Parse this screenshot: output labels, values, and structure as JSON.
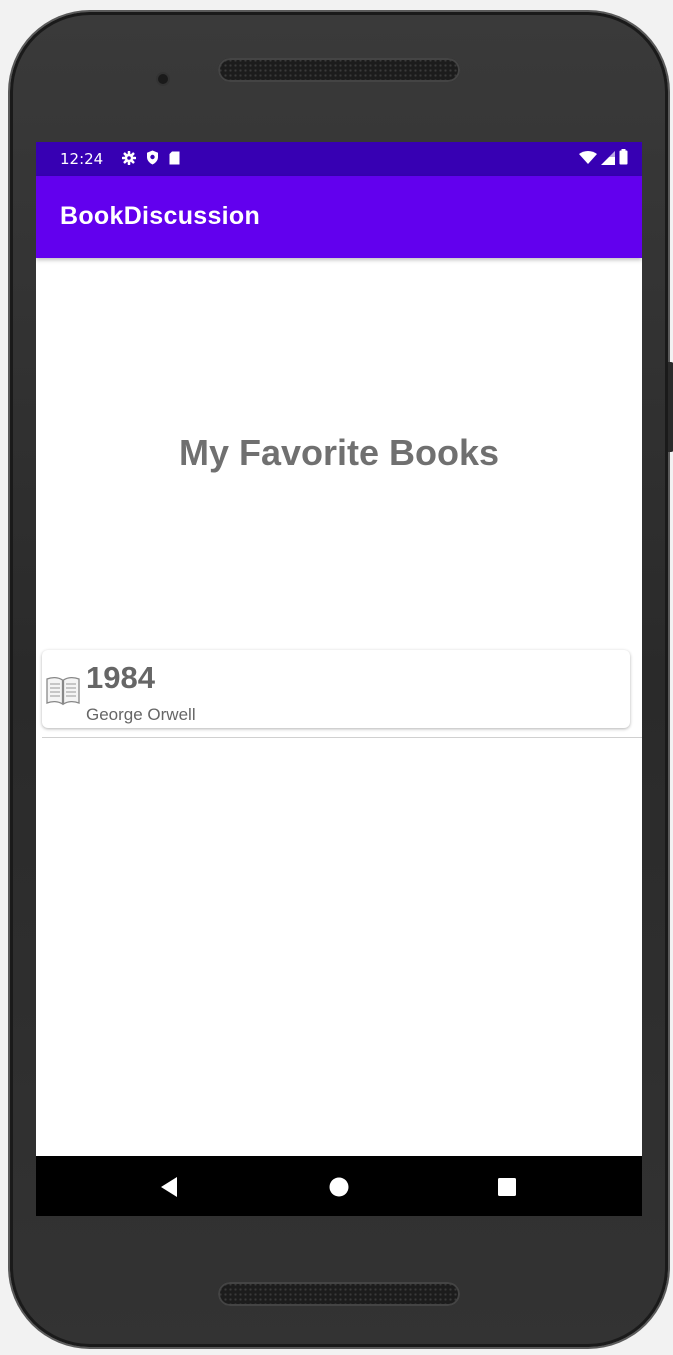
{
  "status_bar": {
    "time": "12:24",
    "left_icons": [
      "gear-icon",
      "shield-icon",
      "sd-card-icon"
    ],
    "right_icons": [
      "wifi-icon",
      "signal-icon",
      "battery-icon"
    ]
  },
  "app_bar": {
    "title": "BookDiscussion"
  },
  "main": {
    "heading": "My Favorite Books",
    "books": [
      {
        "title": "1984",
        "author": "George Orwell",
        "icon": "open-book-icon"
      }
    ]
  },
  "nav_bar": {
    "buttons": [
      "back-icon",
      "home-icon",
      "recents-icon"
    ]
  },
  "colors": {
    "status_bar": "#3700b3",
    "app_bar": "#6200ee",
    "heading_text": "#707070",
    "card_text": "#666666"
  }
}
